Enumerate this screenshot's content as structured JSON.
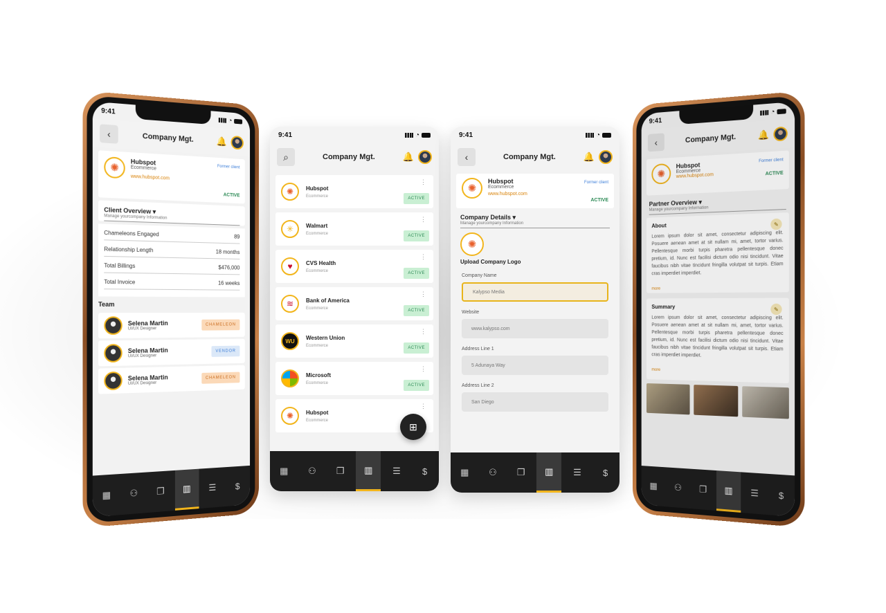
{
  "status": {
    "time": "9:41"
  },
  "header": {
    "title": "Company Mgt."
  },
  "company": {
    "name": "Hubspot",
    "category": "Ecommerce",
    "url": "www.hubspot.com",
    "former": "Former client",
    "status": "ACTIVE"
  },
  "client_overview": {
    "title": "Client Overview",
    "subtitle": "Manage yourcompany Information",
    "rows": [
      {
        "label": "Chameleons Engaged",
        "value": "89"
      },
      {
        "label": "Relationship Length",
        "value": "18 months"
      },
      {
        "label": "Total Billings",
        "value": "$476,000"
      },
      {
        "label": "Total Invoice",
        "value": "16 weeks"
      }
    ]
  },
  "team": {
    "title": "Team",
    "members": [
      {
        "name": "Selena Martin",
        "role": "UI/UX Designer",
        "tag": "CHAMELEON"
      },
      {
        "name": "Selena Martin",
        "role": "UI/UX Designer",
        "tag": "VENDOR"
      },
      {
        "name": "Selena Martin",
        "role": "UI/UX Designer",
        "tag": "CHAMELEON"
      }
    ]
  },
  "companies": [
    {
      "name": "Hubspot",
      "category": "Ecommerce",
      "status": "ACTIVE",
      "icon": "hubspot-logo"
    },
    {
      "name": "Walmart",
      "category": "Ecommerce",
      "status": "ACTIVE",
      "icon": "walmart-logo"
    },
    {
      "name": "CVS Health",
      "category": "Ecommerce",
      "status": "ACTIVE",
      "icon": "cvs-logo"
    },
    {
      "name": "Bank of America",
      "category": "Ecommerce",
      "status": "ACTIVE",
      "icon": "boa-logo"
    },
    {
      "name": "Western Union",
      "category": "Ecommerce",
      "status": "ACTIVE",
      "icon": "wu-logo"
    },
    {
      "name": "Microsoft",
      "category": "Ecommerce",
      "status": "ACTIVE",
      "icon": "microsoft-logo"
    },
    {
      "name": "Hubspot",
      "category": "Ecommerce",
      "status": "",
      "icon": "hubspot-logo"
    }
  ],
  "company_details": {
    "title": "Company Details",
    "subtitle": "Manage yourcompany Information",
    "upload_label": "Upload Company Logo",
    "fields": [
      {
        "label": "Company Name",
        "value": "Kalypso Media"
      },
      {
        "label": "Website",
        "value": "www.kalypso.com"
      },
      {
        "label": "Address Line 1",
        "value": "5 Adunaya Way"
      },
      {
        "label": "Address Line 2",
        "value": "San Diego"
      }
    ]
  },
  "partner": {
    "title": "Partner Overview",
    "subtitle": "Manage yourcompany Information",
    "about_title": "About",
    "about_text": "Lorem ipsum dolor sit amet, consectetur adipiscing elit. Posuere aenean amet at sit nullam mi, amet, tortor varius. Pellentesque morbi turpis pharetra pellentesque donec pretium, id. Nunc est facilisi dictum odio nisi tincidunt. Vitae faucibus nibh vitae tincidunt fringilla volutpat sit turpis. Etiam cras imperdiet imperdiet.",
    "summary_title": "Summary",
    "summary_text": "Lorem ipsum dolor sit amet, consectetur adipiscing elit. Posuere aenean amet at sit nullam mi, amet, tortor varius. Pellentesque morbi turpis pharetra pellentesque donec pretium, id. Nunc est facilisi dictum odio nisi tincidunt. Vitae faucibus nibh vitae tincidunt fringilla volutpat sit turpis. Etiam cras imperdiet imperdiet.",
    "more": "more"
  },
  "colors": {
    "accent": "#f2b51c",
    "active_bg": "#c9efd3",
    "nav_bg": "#1e1e1e"
  }
}
